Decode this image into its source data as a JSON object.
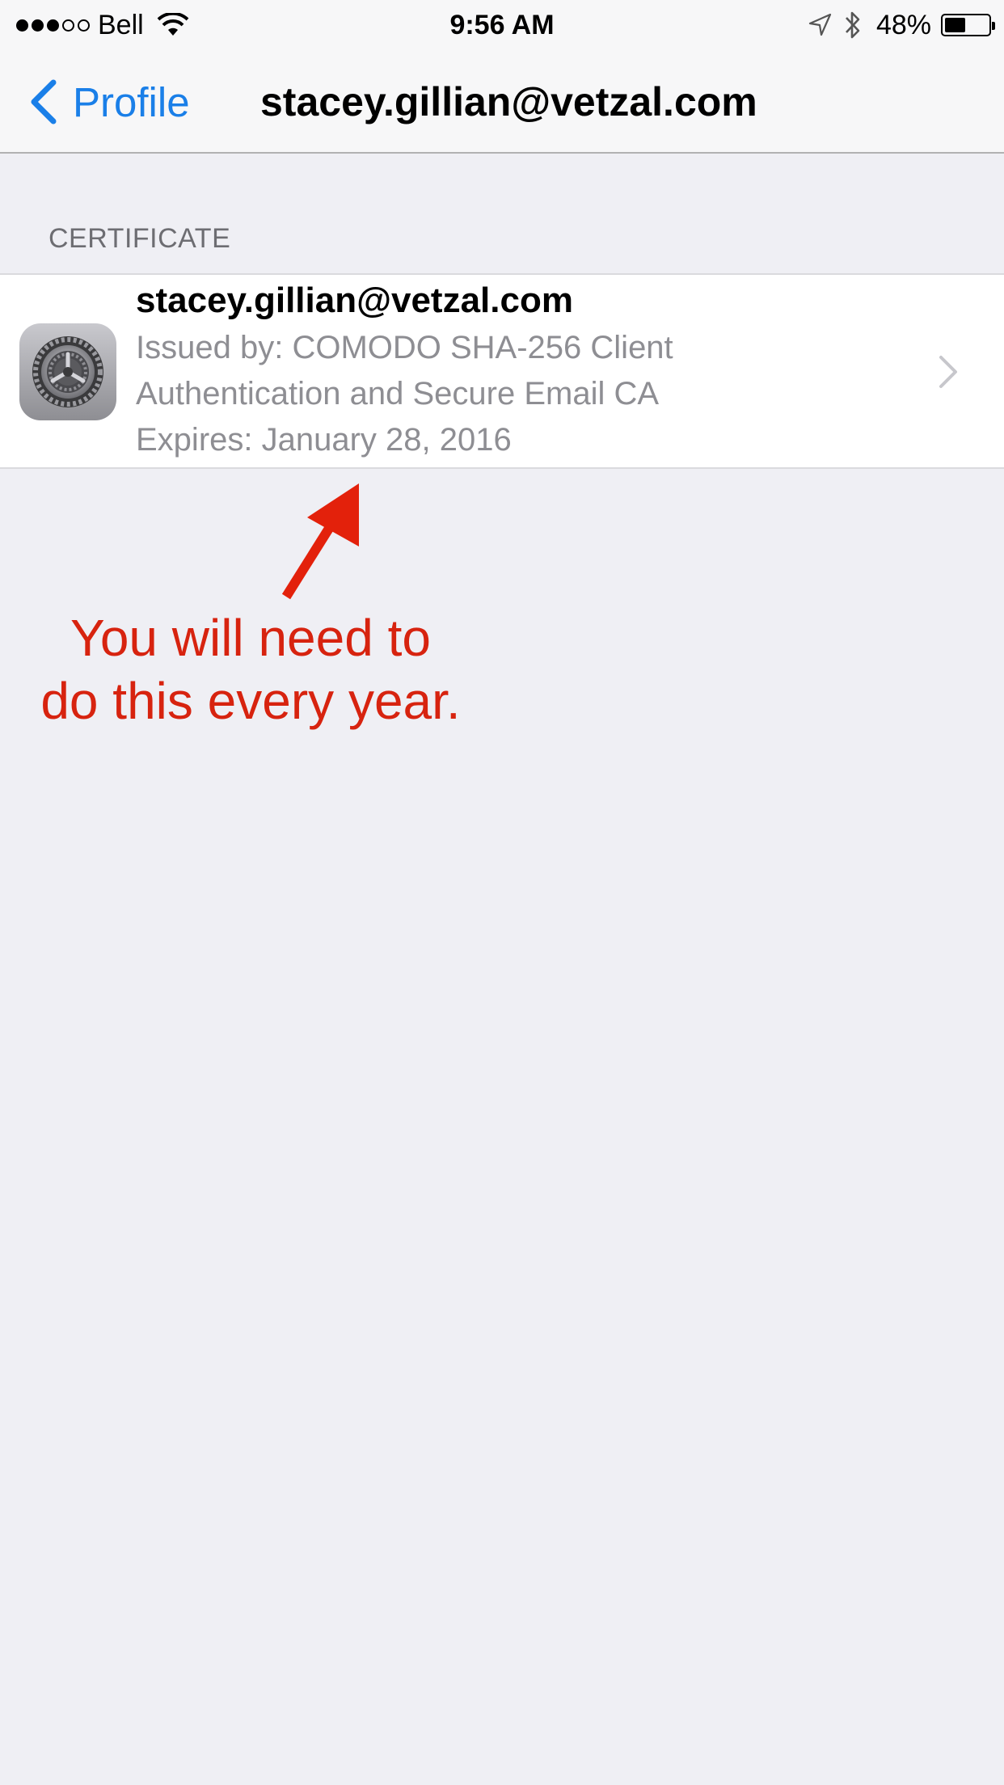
{
  "status_bar": {
    "signal_dots_full": 3,
    "signal_dots_empty": 2,
    "carrier": "Bell",
    "time": "9:56 AM",
    "battery_percent_text": "48%",
    "battery_level": 0.48,
    "icons": [
      "wifi-icon",
      "location-arrow-icon",
      "bluetooth-icon",
      "battery-icon"
    ]
  },
  "nav": {
    "back_label": "Profile",
    "title": "stacey.gillian@vetzal.com"
  },
  "section": {
    "header": "CERTIFICATE"
  },
  "certificate": {
    "name": "stacey.gillian@vetzal.com",
    "issued_by_line1": "Issued by: COMODO SHA-256 Client",
    "issued_by_line2": "Authentication and Secure Email CA",
    "expires": "Expires: January 28, 2016",
    "icon": "settings-gear-icon"
  },
  "annotation": {
    "line1": "You will need to",
    "line2": "do this every year.",
    "color": "#d7230f"
  },
  "colors": {
    "accent": "#1a7fe8",
    "background": "#efeff4",
    "secondary_text": "#8e8e93"
  }
}
